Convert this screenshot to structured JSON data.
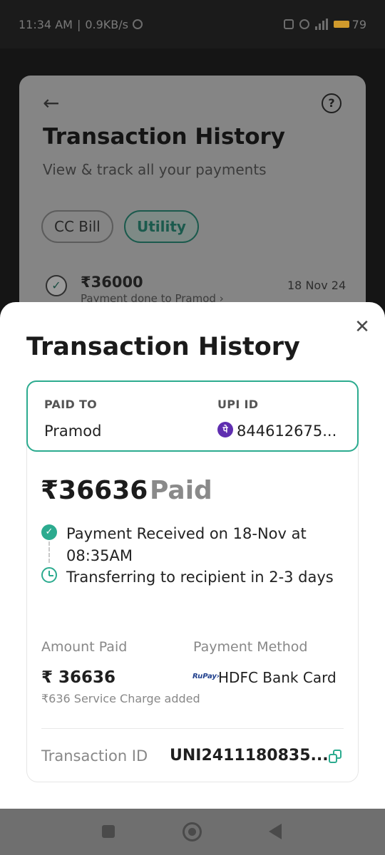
{
  "status_bar": {
    "time": "11:34 AM",
    "speed": "0.9KB/s",
    "battery": "79"
  },
  "background_page": {
    "title": "Transaction History",
    "subtitle": "View & track all your payments",
    "back_icon": "arrow-left-icon",
    "help_icon": "help-icon",
    "help_glyph": "?",
    "filters": [
      {
        "label": "CC Bill",
        "selected": false
      },
      {
        "label": "Utility",
        "selected": true
      }
    ],
    "row": {
      "amount": "₹36000",
      "description": "Payment done to Pramod",
      "date": "18 Nov 24"
    }
  },
  "sheet": {
    "title": "Transaction History",
    "close_icon": "close-icon",
    "paid_to": {
      "label": "PAID TO",
      "value": "Pramod"
    },
    "upi": {
      "label": "UPI ID",
      "icon_glyph": "पे",
      "value": "844612675..."
    },
    "total": {
      "amount": "₹36636",
      "status": "Paid"
    },
    "timeline": [
      {
        "text": "Payment Received on 18-Nov at 08:35AM",
        "icon": "check-circle-icon"
      },
      {
        "text": "Transferring to recipient in 2-3 days",
        "icon": "clock-icon"
      }
    ],
    "amount_paid": {
      "label": "Amount Paid",
      "value": "₹ 36636",
      "note": "₹636 Service Charge added"
    },
    "payment_method": {
      "label": "Payment Method",
      "logo_text": "RuPay›",
      "value": "HDFC Bank Card"
    },
    "transaction": {
      "label": "Transaction ID",
      "value": "UNI2411180835..."
    }
  },
  "colors": {
    "accent": "#2cab8f",
    "phonepe": "#5f2eb0"
  }
}
